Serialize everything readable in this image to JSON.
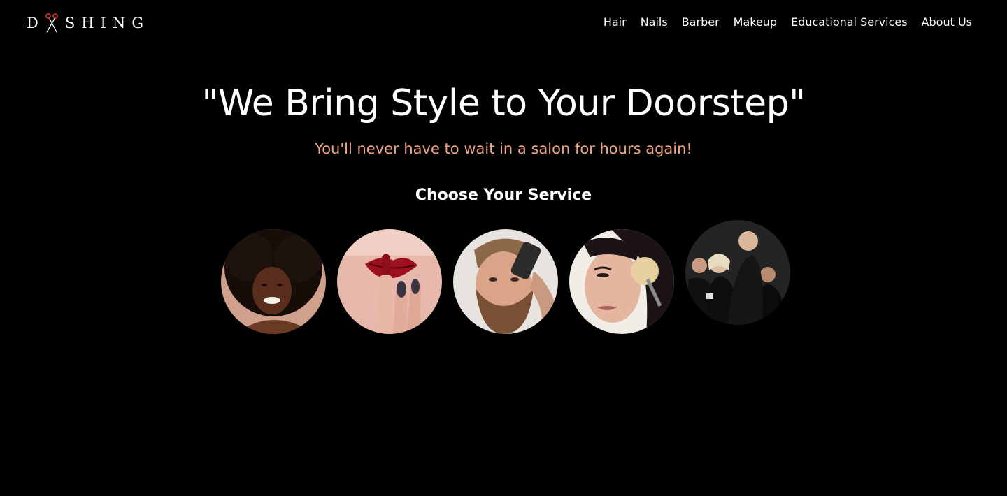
{
  "header": {
    "logo_text": "DASHING",
    "logo_icon": "scissors-icon",
    "nav": [
      {
        "label": "Hair"
      },
      {
        "label": "Nails"
      },
      {
        "label": "Barber"
      },
      {
        "label": "Makeup"
      },
      {
        "label": "Educational Services"
      },
      {
        "label": "About Us"
      }
    ]
  },
  "hero": {
    "title": "\"We Bring Style to Your Doorstep\"",
    "subtitle": "You'll never have to wait in a salon for hours again!"
  },
  "services": {
    "heading": "Choose Your Service",
    "items": [
      {
        "name": "hair",
        "image": "woman-with-afro-photo"
      },
      {
        "name": "nails",
        "image": "red-lips-painted-nails-photo"
      },
      {
        "name": "barber",
        "image": "bearded-man-clipper-photo"
      },
      {
        "name": "makeup",
        "image": "woman-makeup-brush-photo"
      },
      {
        "name": "educational",
        "image": "backstage-makeup-artists-photo"
      }
    ]
  },
  "colors": {
    "background": "#000000",
    "text": "#ffffff",
    "accent_subtitle": "#f0a583",
    "logo_accent": "#d42a2a"
  }
}
